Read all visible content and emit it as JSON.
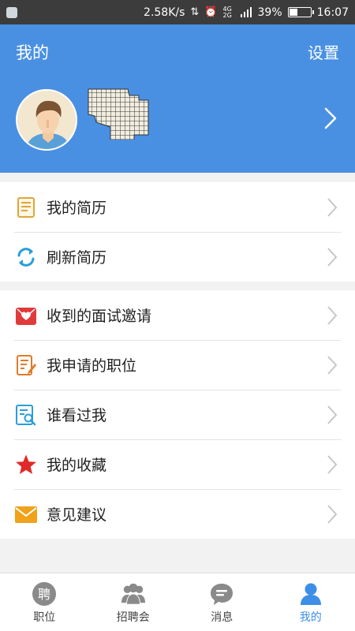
{
  "status_bar": {
    "speed": "2.58K/s",
    "network_label": "4G 2G",
    "battery_level": 0.39,
    "battery_text": "39%",
    "time": "16:07"
  },
  "header": {
    "title": "我的",
    "settings_label": "设置",
    "avatar_icon": "user-avatar",
    "username_redacted": "redacted-name-image"
  },
  "menu_group_1": [
    {
      "label": "我的简历",
      "icon": "resume-icon",
      "color": "#e0a53a"
    },
    {
      "label": "刷新简历",
      "icon": "refresh-icon",
      "color": "#2a9fd8"
    }
  ],
  "menu_group_2": [
    {
      "label": "收到的面试邀请",
      "icon": "invitation-icon",
      "color": "#e03a3a"
    },
    {
      "label": "我申请的职位",
      "icon": "applied-jobs-icon",
      "color": "#e07b2a"
    },
    {
      "label": "谁看过我",
      "icon": "viewers-icon",
      "color": "#2a9fd8"
    },
    {
      "label": "我的收藏",
      "icon": "star-icon",
      "color": "#e02a2a"
    },
    {
      "label": "意见建议",
      "icon": "mail-icon",
      "color": "#f0a21a"
    }
  ],
  "tabbar": [
    {
      "label": "职位",
      "icon": "jobs-icon",
      "active": false
    },
    {
      "label": "招聘会",
      "icon": "job-fair-icon",
      "active": false
    },
    {
      "label": "消息",
      "icon": "message-icon",
      "active": false
    },
    {
      "label": "我的",
      "icon": "profile-icon",
      "active": true
    }
  ],
  "colors": {
    "header_bg": "#4a90e2",
    "accent": "#3d8ee6",
    "inactive_tab": "#8a8a8a"
  }
}
